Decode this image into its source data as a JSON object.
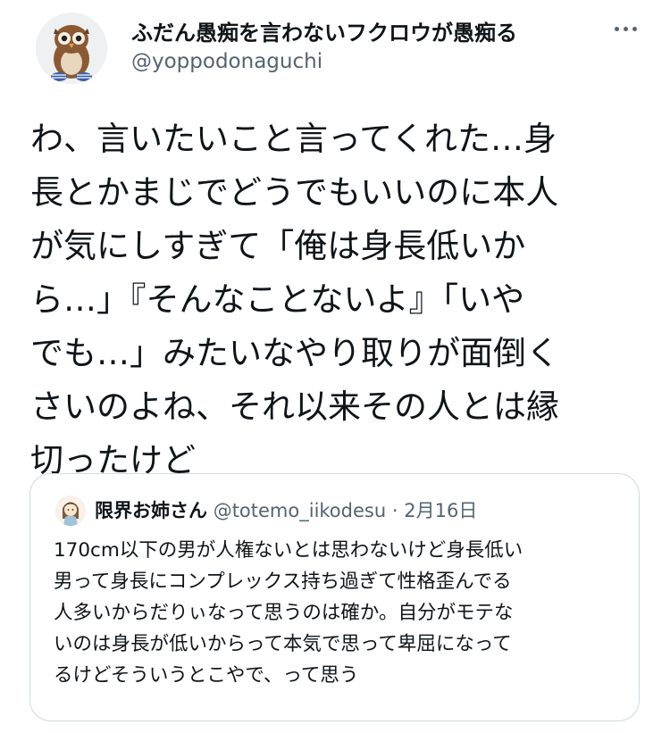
{
  "tweet": {
    "author": {
      "display_name": "ふだん愚痴を言わないフクロウが愚痴る",
      "handle": "@yoppodonaguchi",
      "avatar_icon": "owl-plush-avatar"
    },
    "text": "わ、言いたいこと言ってくれた…身\n長とかまじでどうでもいいのに本人\nが気にしすぎて「俺は身長低いか\nら…」『そんなことないよ』「いや\nでも…」みたいなやり取りが面倒く\nさいのよね、それ以来その人とは縁\n切ったけど",
    "more_icon": "more-dots-icon"
  },
  "quote": {
    "author": {
      "display_name": "限界お姉さん",
      "handle": "@totemo_iikodesu",
      "separator": "·",
      "date": "2月16日",
      "avatar_icon": "illustrated-girl-avatar"
    },
    "text": "170cm以下の男が人権ないとは思わないけど身長低い\n男って身長にコンプレックス持ち過ぎて性格歪んでる\n人多いからだりぃなって思うのは確か。自分がモテな\nいのは身長が低いからって本気で思って卑屈になって\nるけどそういうとこやで、って思う"
  },
  "colors": {
    "text_primary": "#0f1419",
    "text_secondary": "#536471",
    "border": "#cfd9de",
    "background": "#ffffff"
  }
}
